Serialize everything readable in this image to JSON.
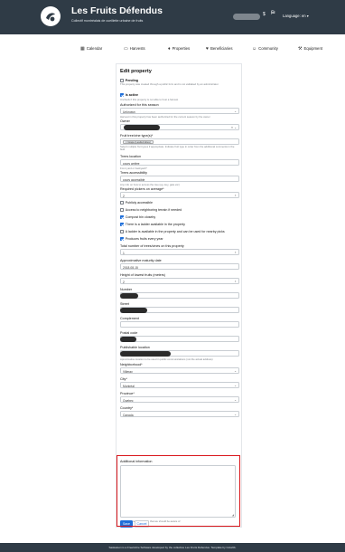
{
  "header": {
    "title": "Les Fruits Défendus",
    "subtitle": "Collectif montréalais de cueillette urbaine de fruits",
    "language_label": "Language: en ▾"
  },
  "nav": {
    "items": [
      {
        "label": "Calendar",
        "icon": "calendar-icon"
      },
      {
        "label": "Harvests",
        "icon": "basket-icon"
      },
      {
        "label": "Properties",
        "icon": "pin-icon"
      },
      {
        "label": "Beneficiaries",
        "icon": "heart-icon"
      },
      {
        "label": "Community",
        "icon": "people-icon"
      },
      {
        "label": "Equipment",
        "icon": "tools-icon"
      }
    ]
  },
  "form": {
    "title": "Edit property",
    "pending": {
      "label": "Pending",
      "help": "This property was created through a public form and is not validated by an administrator.",
      "checked": false
    },
    "active": {
      "label": "Is active",
      "help": "Uncheck if this property is not able to host a harvest",
      "checked": true
    },
    "authorized": {
      "label": "Authorized for this season",
      "value": "Unknown",
      "help": "Harvest in this property has been authorized for the current season by the owner"
    },
    "owner": {
      "label": "Owner"
    },
    "trees": {
      "label": "Fruit tree/vine type(s)*",
      "tag": "× Grape (Lesdecrubes)",
      "help": "Select multiple fruit types if appropriate. Indicate fruit type in order from the additional comments in the field."
    },
    "trees_location": {
      "label": "Trees location",
      "value": "cours arrière",
      "help": "Front yard or backyard?"
    },
    "trees_accessibility": {
      "label": "Trees accessibility",
      "value": "cours accessible",
      "help": "Any info on how to access the tree (eg. key, gate etc)"
    },
    "pickers": {
      "label": "Required pickers on average*",
      "value": "2"
    },
    "checkboxes": [
      {
        "label": "Publicly accessible",
        "checked": false
      },
      {
        "label": "Access to neighboring terrain if needed",
        "checked": false
      },
      {
        "label": "Compost bin closeby",
        "checked": true
      },
      {
        "label": "There is a ladder available in the property",
        "checked": true
      },
      {
        "label": "A ladder is available in the property and can be used for nearby picks",
        "checked": false
      },
      {
        "label": "Produces fruits every year",
        "checked": true
      }
    ],
    "total_trees": {
      "label": "Total number of trees/vines on this property",
      "value": "1"
    },
    "maturity": {
      "label": "Approximative maturity date",
      "value": "2018-08-15"
    },
    "height": {
      "label": "Height of lowest fruits (meters)",
      "value": "2"
    },
    "number": {
      "label": "Number"
    },
    "street": {
      "label": "Street"
    },
    "complement": {
      "label": "Complement"
    },
    "postal": {
      "label": "Postal code"
    },
    "publishable": {
      "label": "Publishable location",
      "help": "Aproximative location to be used in public communications (not the actual address)"
    },
    "neighborhood": {
      "label": "Neighborhood*",
      "value": "Villeray"
    },
    "city": {
      "label": "City*",
      "value": "Montréal"
    },
    "province": {
      "label": "Province*",
      "value": "Quebec"
    },
    "country": {
      "label": "Country*",
      "value": "Canada"
    },
    "additional": {
      "label": "Additional information",
      "help": "Any additional information that we should be aware of"
    },
    "save_label": "Save",
    "cancel_label": "Cancel"
  },
  "footer": {
    "text": "Saskatoon is a Free/Libre Software developed by the collective Les Fruits Défendus. Template by Colorlib."
  },
  "colors": {
    "header_bg": "#2f3b46",
    "accent": "#1f6fd9",
    "highlight": "#d9171c"
  }
}
